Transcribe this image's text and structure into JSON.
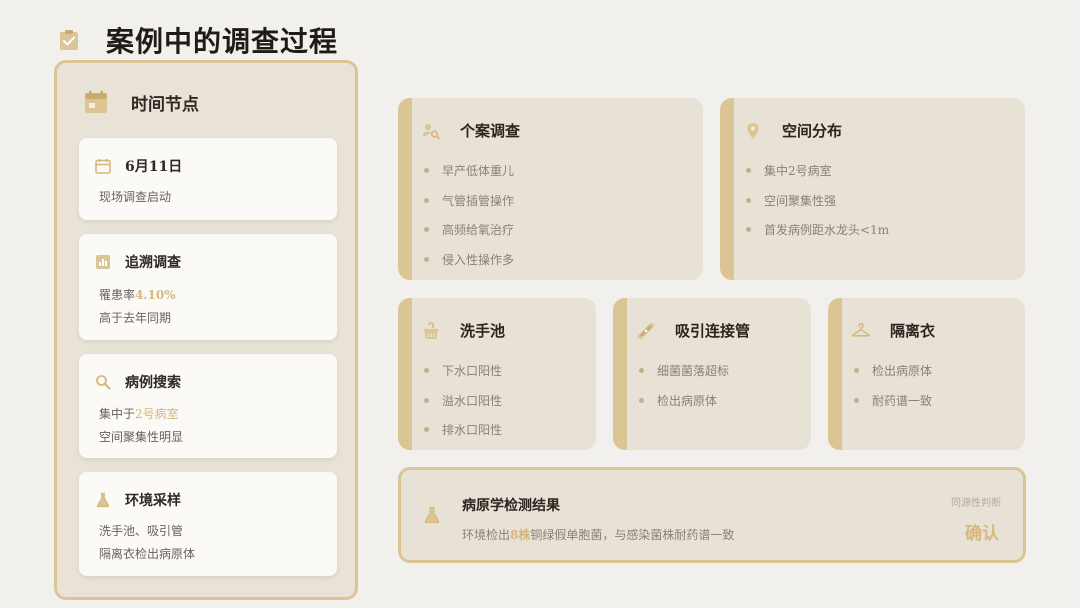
{
  "page": {
    "title": "案例中的调查过程",
    "icon": "clipboard-check-icon"
  },
  "timeline": {
    "title": "时间节点",
    "icon": "calendar-icon",
    "events": [
      {
        "icon": "calendar-icon",
        "title": "6月11日",
        "lines": [
          "现场调查启动"
        ]
      },
      {
        "icon": "bar-chart-icon",
        "title": "追溯调查",
        "line1_prefix": "罹患率",
        "line1_highlight": "4.10%",
        "line2": "高于去年同期"
      },
      {
        "icon": "search-icon",
        "title": "病例搜索",
        "line1_prefix": "集中于",
        "line1_highlight": "2号病室",
        "line2": "空间聚集性明显"
      },
      {
        "icon": "flask-icon",
        "title": "环境采样",
        "lines": [
          "洗手池、吸引管",
          "隔离衣检出病原体"
        ]
      }
    ]
  },
  "cards": {
    "case_investigation": {
      "icon": "person-search-icon",
      "title": "个案调查",
      "items": [
        "早产低体重儿",
        "气管插管操作",
        "高频给氧治疗",
        "侵入性操作多"
      ]
    },
    "spatial_distribution": {
      "icon": "map-pin-icon",
      "title": "空间分布",
      "items": [
        "集中2号病室",
        "空间聚集性强",
        "首发病例距水龙头<1m"
      ]
    },
    "sink": {
      "icon": "sink-icon",
      "title": "洗手池",
      "items": [
        "下水口阳性",
        "溢水口阳性",
        "排水口阳性"
      ]
    },
    "suction_tube": {
      "icon": "tube-connector-icon",
      "title": "吸引连接管",
      "items": [
        "细菌菌落超标",
        "检出病原体"
      ]
    },
    "isolation_gown": {
      "icon": "hanger-icon",
      "title": "隔离衣",
      "items": [
        "检出病原体",
        "耐药谱一致"
      ]
    }
  },
  "result": {
    "icon": "flask-icon",
    "title": "病原学检测结果",
    "desc_prefix": "环境检出",
    "desc_highlight": "8株",
    "desc_suffix": "铜绿假单胞菌，与感染菌株耐药谱一致",
    "verdict_label": "同源性判断",
    "verdict_value": "确认"
  },
  "colors": {
    "accent": "#dcc595",
    "highlight": "#d6b77c",
    "background": "#f2f0ec",
    "card": "#e8e2d6"
  }
}
